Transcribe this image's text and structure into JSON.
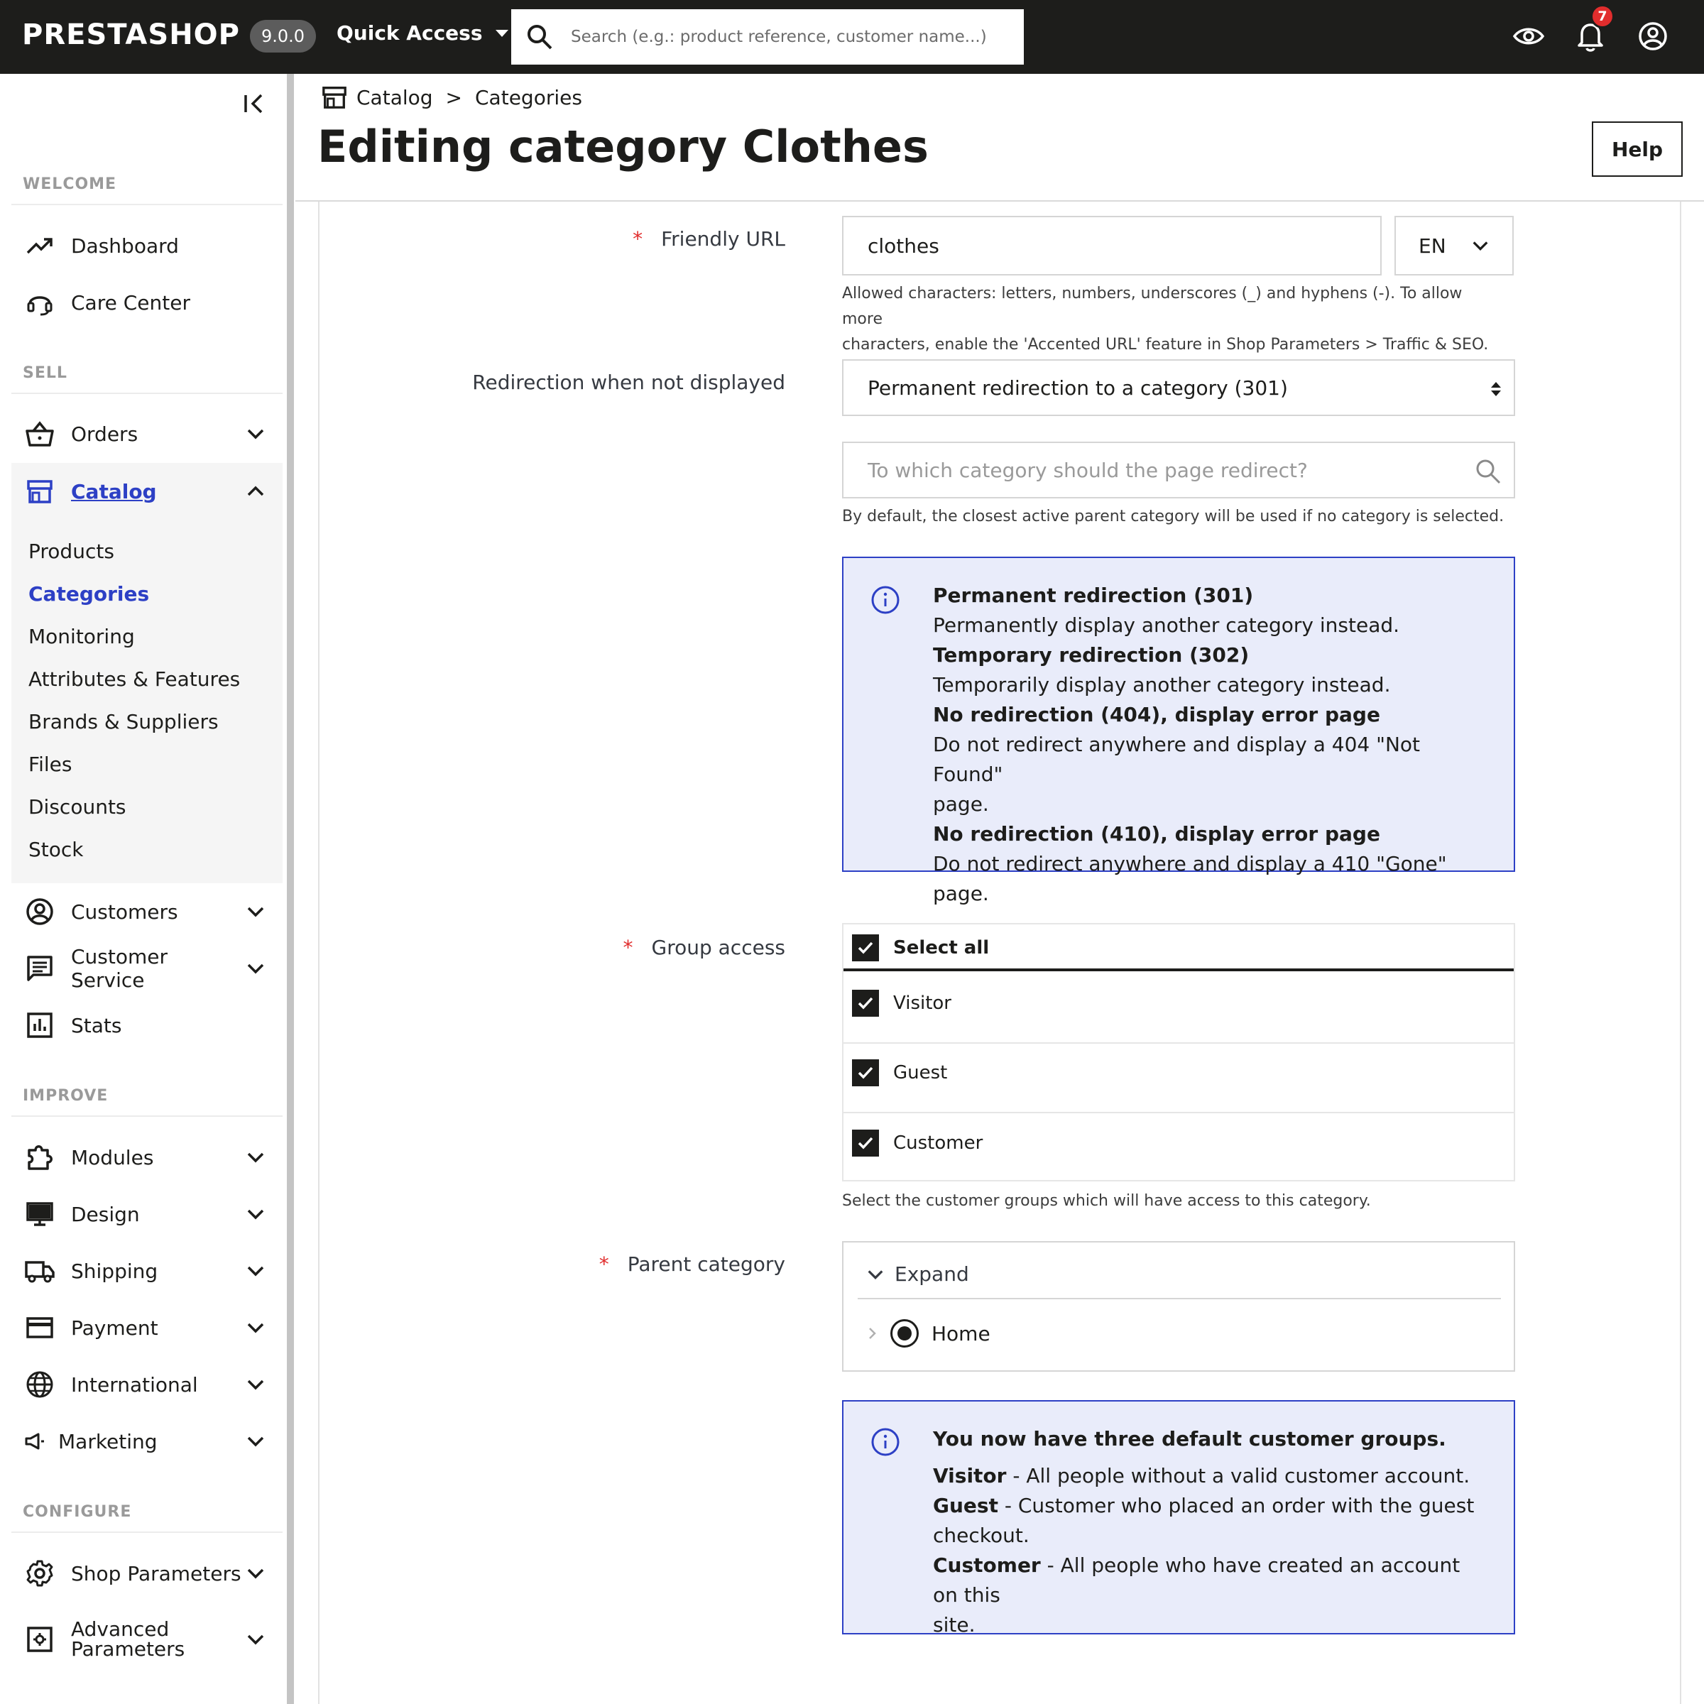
{
  "topbar": {
    "logo": "PRESTASHOP",
    "version": "9.0.0",
    "quick_access": "Quick Access",
    "search_placeholder": "Search (e.g.: product reference, customer name...)",
    "notifications_count": "7"
  },
  "sidebar": {
    "sections": {
      "welcome": "WELCOME",
      "sell": "SELL",
      "improve": "IMPROVE",
      "configure": "CONFIGURE"
    },
    "items": {
      "dashboard": "Dashboard",
      "care_center": "Care Center",
      "orders": "Orders",
      "catalog": "Catalog",
      "customers": "Customers",
      "customer_service": "Customer Service",
      "stats": "Stats",
      "modules": "Modules",
      "design": "Design",
      "shipping": "Shipping",
      "payment": "Payment",
      "international": "International",
      "marketing": "Marketing",
      "shop_parameters": "Shop Parameters",
      "advanced_parameters_1": "Advanced",
      "advanced_parameters_2": "Parameters"
    },
    "catalog_sub": {
      "products": "Products",
      "categories": "Categories",
      "monitoring": "Monitoring",
      "attributes": "Attributes & Features",
      "brands": "Brands & Suppliers",
      "files": "Files",
      "discounts": "Discounts",
      "stock": "Stock"
    }
  },
  "header": {
    "breadcrumb_1": "Catalog",
    "breadcrumb_sep": ">",
    "breadcrumb_2": "Categories",
    "title": "Editing category Clothes",
    "help": "Help"
  },
  "form": {
    "required_mark": "*",
    "friendly_url": {
      "label": "Friendly URL",
      "value": "clothes",
      "lang": "EN",
      "help_1": "Allowed characters: letters, numbers, underscores (_) and hyphens (-). To allow more",
      "help_2": "characters, enable the 'Accented URL' feature in Shop Parameters > Traffic & SEO."
    },
    "redirection": {
      "label": "Redirection when not displayed",
      "value": "Permanent redirection to a category (301)",
      "target_placeholder": "To which category should the page redirect?",
      "help": "By default, the closest active parent category will be used if no category is selected."
    },
    "redirect_info": {
      "h1": "Permanent redirection (301)",
      "t1": "Permanently display another category instead.",
      "h2": "Temporary redirection (302)",
      "t2": "Temporarily display another category instead.",
      "h3": "No redirection (404), display error page",
      "t3a": "Do not redirect anywhere and display a 404 \"Not Found\"",
      "t3b": "page.",
      "h4": "No redirection (410), display error page",
      "t4": "Do not redirect anywhere and display a 410 \"Gone\" page."
    },
    "group_access": {
      "label": "Group access",
      "select_all": "Select all",
      "groups": [
        "Visitor",
        "Guest",
        "Customer"
      ],
      "help": "Select the customer groups which will have access to this category."
    },
    "parent_category": {
      "label": "Parent category",
      "expand": "Expand",
      "node": "Home"
    },
    "groups_info": {
      "title": "You now have three default customer groups.",
      "visitor_b": "Visitor",
      "visitor_t": " - All people without a valid customer account.",
      "guest_b": "Guest",
      "guest_t": " - Customer who placed an order with the guest",
      "guest_t2": "checkout.",
      "customer_b": "Customer",
      "customer_t": " - All people who have created an account on this",
      "customer_t2": "site."
    }
  },
  "colors": {
    "topbar": "#1d1d1b",
    "accent": "#2d40c5",
    "info_bg": "#e9ecfa",
    "required": "#e12d2d"
  }
}
